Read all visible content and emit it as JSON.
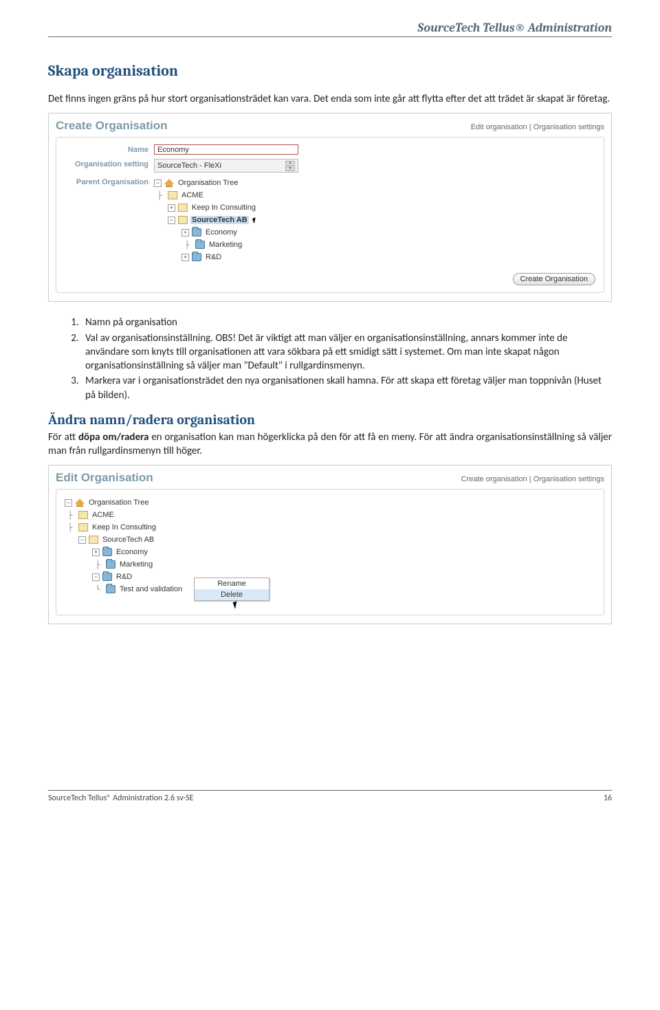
{
  "header": {
    "title": "SourceTech Tellus® Administration"
  },
  "section1": {
    "heading": "Skapa organisation",
    "intro": "Det finns ingen gräns på hur stort organisationsträdet kan vara. Det enda som inte går att flytta efter det att trädet är skapat är företag."
  },
  "screenshot1": {
    "title": "Create Organisation",
    "link1": "Edit organisation",
    "link2": "Organisation settings",
    "labels": {
      "name": "Name",
      "orgsetting": "Organisation setting",
      "parent": "Parent Organisation"
    },
    "nameValue": "Economy",
    "orgSettingValue": "SourceTech - FleXi",
    "tree": {
      "root": "Organisation Tree",
      "n1": "ACME",
      "n2": "Keep In Consulting",
      "n3": "SourceTech AB",
      "c1": "Economy",
      "c2": "Marketing",
      "c3": "R&D"
    },
    "button": "Create Organisation"
  },
  "steps": {
    "s1": "Namn på organisation",
    "s2": "Val av organisationsinställning. OBS! Det är viktigt att man väljer en organisationsinställning, annars kommer inte de användare som knyts till organisationen att vara sökbara på ett smidigt sätt i systemet. Om man inte skapat någon organisationsinställning så väljer man \"Default\" i rullgardinsmenyn.",
    "s3": "Markera var i organisationsträdet den nya organisationen skall hamna. För att skapa ett företag väljer man toppnivån (Huset på bilden)."
  },
  "section2": {
    "heading": "Ändra namn/radera organisation",
    "p1_a": "För att ",
    "p1_b": "döpa om/radera",
    "p1_c": " en organisation kan man högerklicka på den för att få en meny. För att ändra organisationsinställning så väljer man från rullgardinsmenyn till höger."
  },
  "screenshot2": {
    "title": "Edit Organisation",
    "link1": "Create organisation",
    "link2": "Organisation settings",
    "tree": {
      "root": "Organisation Tree",
      "n1": "ACME",
      "n2": "Keep In Consulting",
      "n3": "SourceTech AB",
      "c1": "Economy",
      "c2": "Marketing",
      "c3": "R&D",
      "c4": "Test and validation"
    },
    "menu": {
      "rename": "Rename",
      "delete": "Delete"
    }
  },
  "footer": {
    "left": "SourceTech Tellus® Administration 2.6 sv-SE",
    "right": "16"
  }
}
